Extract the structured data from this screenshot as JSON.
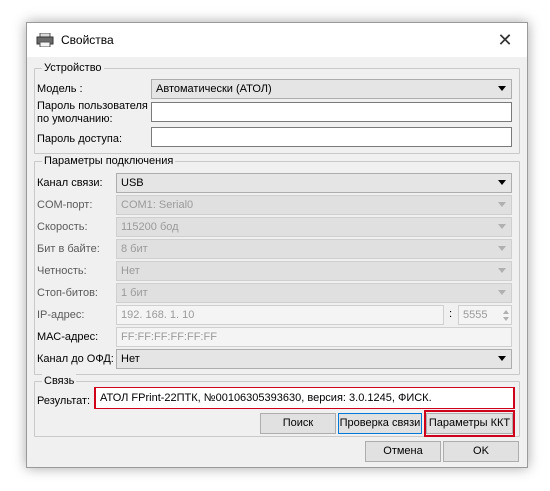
{
  "window": {
    "title": "Свойства",
    "close_symbol": "✕"
  },
  "device": {
    "title": "Устройство",
    "model_label": "Модель :",
    "model_value": "Автоматически (АТОЛ)",
    "user_password_label_line1": "Пароль пользователя",
    "user_password_label_line2": "по умолчанию:",
    "user_password_value": "",
    "access_password_label": "Пароль доступа:",
    "access_password_value": ""
  },
  "connection": {
    "title": "Параметры подключения",
    "channel_label": "Канал связи:",
    "channel_value": "USB",
    "com_label": "COM-порт:",
    "com_value": "COM1: Serial0",
    "speed_label": "Скорость:",
    "speed_value": "115200 бод",
    "bits_label": "Бит в байте:",
    "bits_value": "8 бит",
    "parity_label": "Четность:",
    "parity_value": "Нет",
    "stopbits_label": "Стоп-битов:",
    "stopbits_value": "1 бит",
    "ip_label": "IP-адрес:",
    "ip_value": "192. 168. 1. 10",
    "port_separator": ":",
    "port_value": "5555",
    "mac_label": "МАС-адрес:",
    "mac_value": "FF:FF:FF:FF:FF:FF",
    "ofd_label": "Канал до ОФД:",
    "ofd_value": "Нет"
  },
  "link": {
    "title": "Связь",
    "result_label": "Результат:",
    "result_value": "АТОЛ FPrint-22ПТК, №00106305393630, версия: 3.0.1245, ФИСК.",
    "search_button": "Поиск",
    "check_button": "Проверка связи",
    "kkt_params_button": "Параметры ККТ"
  },
  "footer": {
    "cancel_button": "Отмена",
    "ok_button": "OK"
  },
  "colors": {
    "highlight": "#d0021b",
    "focus": "#0078d7"
  }
}
